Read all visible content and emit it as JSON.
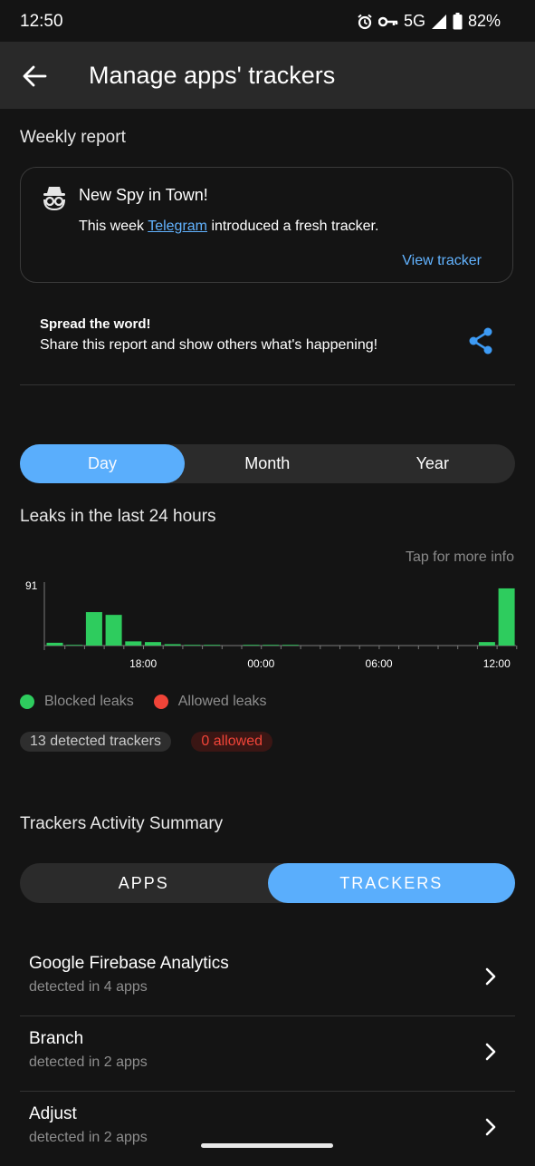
{
  "status": {
    "time": "12:50",
    "network": "5G",
    "battery": "82%"
  },
  "appbar": {
    "title": "Manage apps' trackers"
  },
  "weekly": {
    "label": "Weekly report",
    "card": {
      "heading": "New Spy in Town!",
      "body_prefix": "This week ",
      "app_link": "Telegram",
      "body_suffix": " introduced a fresh tracker.",
      "action": "View tracker"
    },
    "spread": {
      "heading": "Spread the word!",
      "text": "Share this report and show others what's happening!"
    }
  },
  "period": {
    "options": [
      "Day",
      "Month",
      "Year"
    ],
    "selected": "Day"
  },
  "chart_section": {
    "title": "Leaks in the last 24 hours",
    "hint": "Tap for more info"
  },
  "chart_data": {
    "type": "bar",
    "ymax_label": "91",
    "ylim": [
      0,
      91
    ],
    "x_tick_labels": [
      "18:00",
      "00:00",
      "06:00",
      "12:00"
    ],
    "x_tick_slots": [
      5,
      11,
      17,
      23
    ],
    "series": [
      {
        "name": "Blocked leaks",
        "color": "#2ecc5e",
        "values": [
          4,
          1,
          48,
          44,
          6,
          5,
          2,
          1,
          1,
          0,
          1,
          1,
          1,
          0,
          0,
          0,
          0,
          0,
          0,
          0,
          0,
          0,
          5,
          82
        ]
      },
      {
        "name": "Allowed leaks",
        "color": "#f04438",
        "values": [
          0,
          0,
          0,
          0,
          0,
          0,
          0,
          0,
          0,
          0,
          0,
          0,
          0,
          0,
          0,
          0,
          0,
          0,
          0,
          0,
          0,
          0,
          0,
          0
        ]
      }
    ],
    "legend": [
      "Blocked leaks",
      "Allowed leaks"
    ]
  },
  "stats": {
    "detected": "13 detected trackers",
    "allowed": "0 allowed"
  },
  "summary": {
    "label": "Trackers Activity Summary",
    "tabs": [
      "APPS",
      "TRACKERS"
    ],
    "selected": "TRACKERS",
    "items": [
      {
        "name": "Google Firebase Analytics",
        "sub": "detected in 4 apps"
      },
      {
        "name": "Branch",
        "sub": "detected in 2 apps"
      },
      {
        "name": "Adjust",
        "sub": "detected in 2 apps"
      }
    ]
  },
  "colors": {
    "accent": "#5aaefc",
    "link": "#62b3ff",
    "blocked": "#2ecc5e",
    "allowed": "#f04438"
  }
}
